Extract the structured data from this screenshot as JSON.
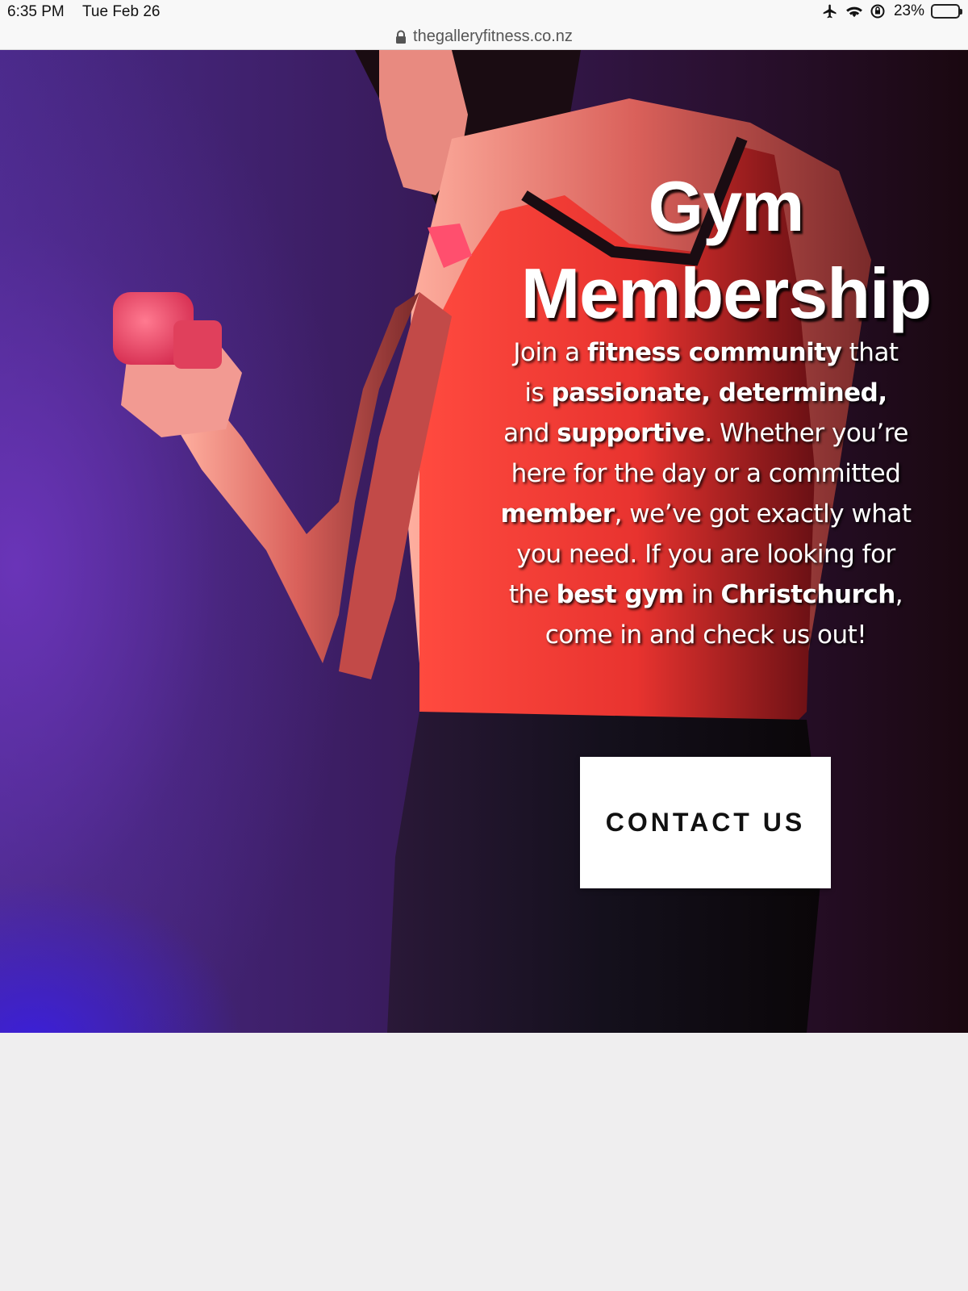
{
  "status_bar": {
    "time": "6:35 PM",
    "date": "Tue Feb 26",
    "battery_percent": "23%",
    "battery_level": 0.23,
    "icons": [
      "airplane-icon",
      "wifi-icon",
      "orientation-lock-icon",
      "battery-icon"
    ]
  },
  "browser": {
    "url": "thegalleryfitness.co.nz",
    "icon": "lock-icon"
  },
  "hero": {
    "title_line1": "Gym",
    "title_line2": "Membership",
    "copy": {
      "t1": "Join a ",
      "b1": "fitness community",
      "t2": " that is ",
      "b2": "passionate, determined,",
      "t3": " and ",
      "b3": "supportive",
      "t4": ". Whether you’re here for the day or a committed ",
      "b4": "member",
      "t5": ", we’ve got exactly what you need. If you are looking for the ",
      "b5": "best gym",
      "t6": " in ",
      "b6": "Christchurch",
      "t7": ", come in and check us out!"
    },
    "button_label": "CONTACT US"
  },
  "colors": {
    "hero_purple": "#4a2a8a",
    "hero_dark": "#1a0810",
    "tank_top_red": "#e8332f",
    "dumbbell_pink": "#ff4f6e",
    "page_background": "#efeeef"
  }
}
